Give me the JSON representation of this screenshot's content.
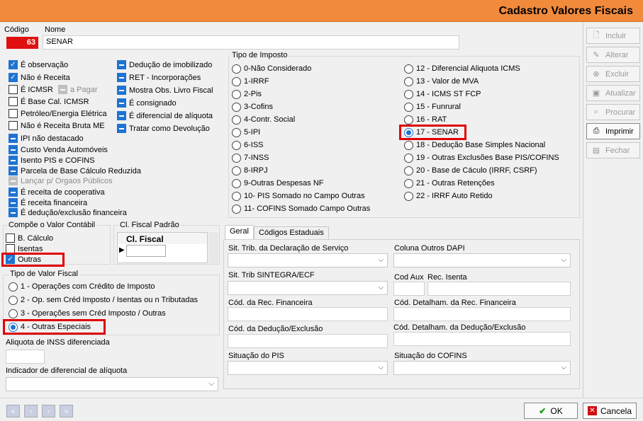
{
  "window": {
    "title": "Cadastro Valores Fiscais"
  },
  "header": {
    "codigo_label": "Código",
    "codigo_value": "63",
    "nome_label": "Nome",
    "nome_value": "SENAR"
  },
  "flags": {
    "col1": [
      {
        "label": "É observação",
        "state": "checked"
      },
      {
        "label": "Não é Receita",
        "state": "checked"
      },
      {
        "label": "É ICMSR",
        "state": "unchecked"
      },
      {
        "label": "É Base Cal. ICMSR",
        "state": "unchecked"
      },
      {
        "label": "Petróleo/Energia Elétrica",
        "state": "unchecked"
      },
      {
        "label": "Não é Receita Bruta ME",
        "state": "unchecked"
      },
      {
        "label": "IPI não destacado",
        "state": "blue"
      },
      {
        "label": "Custo Venda Automóveis",
        "state": "blue"
      },
      {
        "label": "Isento PIS e COFINS",
        "state": "blue"
      },
      {
        "label": "Parcela de Base Cálculo Reduzida",
        "state": "blue"
      },
      {
        "label": "Lançar p/ Orgaos Públicos",
        "state": "disabled"
      },
      {
        "label": "É receita de cooperativa",
        "state": "blue"
      },
      {
        "label": "É receita financeira",
        "state": "blue"
      },
      {
        "label": "É dedução/exclusão financeira",
        "state": "blue"
      }
    ],
    "a_pagar": "a Pagar",
    "col2": [
      {
        "label": "Dedução de imobilizado"
      },
      {
        "label": "RET - Incorporações"
      },
      {
        "label": "Mostra Obs. Livro Fiscal"
      },
      {
        "label": "É consignado"
      },
      {
        "label": "É diferencial de alíquota"
      },
      {
        "label": "Tratar como Devolução"
      }
    ]
  },
  "tipo_imposto": {
    "label": "Tipo de Imposto",
    "left": [
      "0-Não Considerado",
      "1-IRRF",
      "2-Pis",
      "3-Cofins",
      "4-Contr. Social",
      "5-IPI",
      "6-ISS",
      "7-INSS",
      "8-IRPJ",
      "9-Outras Despesas NF",
      "10- PIS Somado no Campo Outras",
      "11- COFINS Somado Campo Outras"
    ],
    "right": [
      "12 - Diferencial Aliquota ICMS",
      "13 - Valor de MVA",
      "14 - ICMS ST FCP",
      "15 - Funrural",
      "16 - RAT",
      "17 - SENAR",
      "18 - Dedução Base Simples Nacional",
      "19 - Outras Exclusões Base PIS/COFINS",
      "20 - Base de Cáculo (IRRF, CSRF)",
      "21 - Outras Retenções",
      "22 - IRRF Auto Retido"
    ],
    "selected": "17 - SENAR"
  },
  "compoe": {
    "label": "Compõe o Valor Contábil",
    "items": [
      {
        "label": "B. Cálculo",
        "state": "unchecked"
      },
      {
        "label": "Isentas",
        "state": "unchecked"
      },
      {
        "label": "Outras",
        "state": "checked"
      }
    ]
  },
  "cl_fiscal": {
    "label": "Cl. Fiscal Padrão",
    "column": "Cl. Fiscal"
  },
  "tipo_valor": {
    "label": "Tipo de Valor Fiscal",
    "items": [
      "1 - Operações com Crédito de Imposto",
      "2 - Op. sem Créd Imposto / Isentas ou n Tributadas",
      "3 - Operações sem Créd Imposto / Outras",
      "4 - Outras Especiais"
    ],
    "selected": "4 - Outras Especiais"
  },
  "aliquota_inss": {
    "label": "Aliquota de INSS diferenciada"
  },
  "indicador": {
    "label": "Indicador de diferencial de alíquota"
  },
  "tabs": {
    "geral": "Geral",
    "codigos": "Códigos Estaduais"
  },
  "geral": {
    "sit_trib_servico": "Sit. Trib. da Declaração de Serviço",
    "coluna_dapi": "Coluna Outros DAPI",
    "sit_trib_sintegra": "Sit. Trib SINTEGRA/ECF",
    "cod_aux": "Cod Aux",
    "rec_isenta": "Rec. Isenta",
    "cod_rec_fin": "Cód. da Rec. Financeira",
    "cod_det_rec_fin": "Cód. Detalham. da Rec. Financeira",
    "cod_deducao": "Cód. da Dedução/Exclusão",
    "cod_det_deducao": "Cód. Detalham. da Dedução/Exclusão",
    "sit_pis": "Situação do PIS",
    "sit_cofins": "Situação do COFINS"
  },
  "actions": {
    "incluir": "Incluir",
    "alterar": "Alterar",
    "excluir": "Excluir",
    "atualizar": "Atualizar",
    "procurar": "Procurar",
    "imprimir": "Imprimir",
    "fechar": "Fechar"
  },
  "footer": {
    "ok": "OK",
    "cancela": "Cancela"
  }
}
